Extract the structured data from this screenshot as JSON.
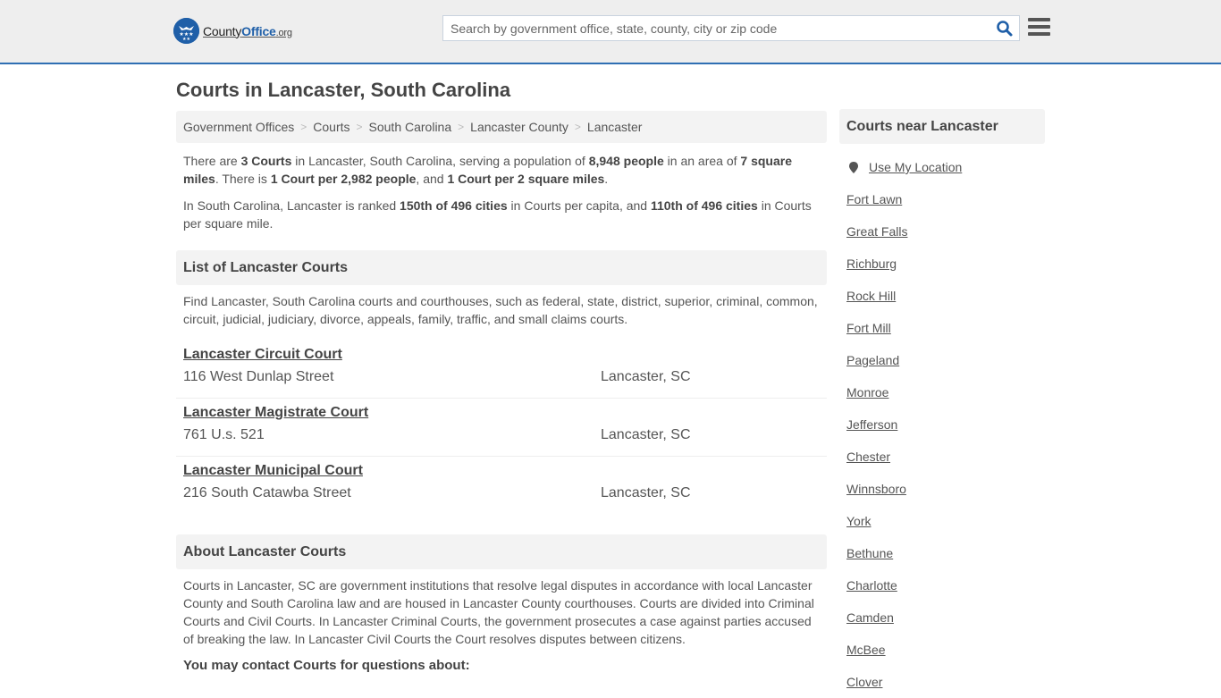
{
  "header": {
    "logo_text_main": "County",
    "logo_text_brand": "Office",
    "logo_text_tld": ".org",
    "search_placeholder": "Search by government office, state, county, city or zip code",
    "search_value": "",
    "brand_color": "#1f5fa8"
  },
  "page_title": "Courts in Lancaster, South Carolina",
  "breadcrumb": [
    {
      "label": "Government Offices"
    },
    {
      "label": "Courts"
    },
    {
      "label": "South Carolina"
    },
    {
      "label": "Lancaster County"
    },
    {
      "label": "Lancaster"
    }
  ],
  "summary": {
    "p1": {
      "t1": "There are ",
      "b1": "3 Courts",
      "t2": " in Lancaster, South Carolina, serving a population of ",
      "b2": "8,948 people",
      "t3": " in an area of ",
      "b3": "7 square miles",
      "t4": ". There is ",
      "b4": "1 Court per 2,982 people",
      "t5": ", and ",
      "b5": "1 Court per 2 square miles",
      "t6": "."
    },
    "p2": {
      "t1": "In South Carolina, Lancaster is ranked ",
      "b1": "150th of 496 cities",
      "t2": " in Courts per capita, and ",
      "b2": "110th of 496 cities",
      "t3": " in Courts per square mile."
    }
  },
  "list_section": {
    "title": "List of Lancaster Courts",
    "description": "Find Lancaster, South Carolina courts and courthouses, such as federal, state, district, superior, criminal, common, circuit, judicial, judiciary, divorce, appeals, family, traffic, and small claims courts.",
    "courts": [
      {
        "name": "Lancaster Circuit Court",
        "address": "116 West Dunlap Street",
        "city": "Lancaster, SC"
      },
      {
        "name": "Lancaster Magistrate Court",
        "address": "761 U.s. 521",
        "city": "Lancaster, SC"
      },
      {
        "name": "Lancaster Municipal Court",
        "address": "216 South Catawba Street",
        "city": "Lancaster, SC"
      }
    ]
  },
  "about_section": {
    "title": "About Lancaster Courts",
    "text": "Courts in Lancaster, SC are government institutions that resolve legal disputes in accordance with local Lancaster County and South Carolina law and are housed in Lancaster County courthouses. Courts are divided into Criminal Courts and Civil Courts. In Lancaster Criminal Courts, the government prosecutes a case against parties accused of breaking the law. In Lancaster Civil Courts the Court resolves disputes between citizens.",
    "contact_heading": "You may contact Courts for questions about:"
  },
  "sidebar": {
    "title": "Courts near Lancaster",
    "use_location": "Use My Location",
    "cities": [
      "Fort Lawn",
      "Great Falls",
      "Richburg",
      "Rock Hill",
      "Fort Mill",
      "Pageland",
      "Monroe",
      "Jefferson",
      "Chester",
      "Winnsboro",
      "York",
      "Bethune",
      "Charlotte",
      "Camden",
      "McBee",
      "Clover"
    ]
  }
}
